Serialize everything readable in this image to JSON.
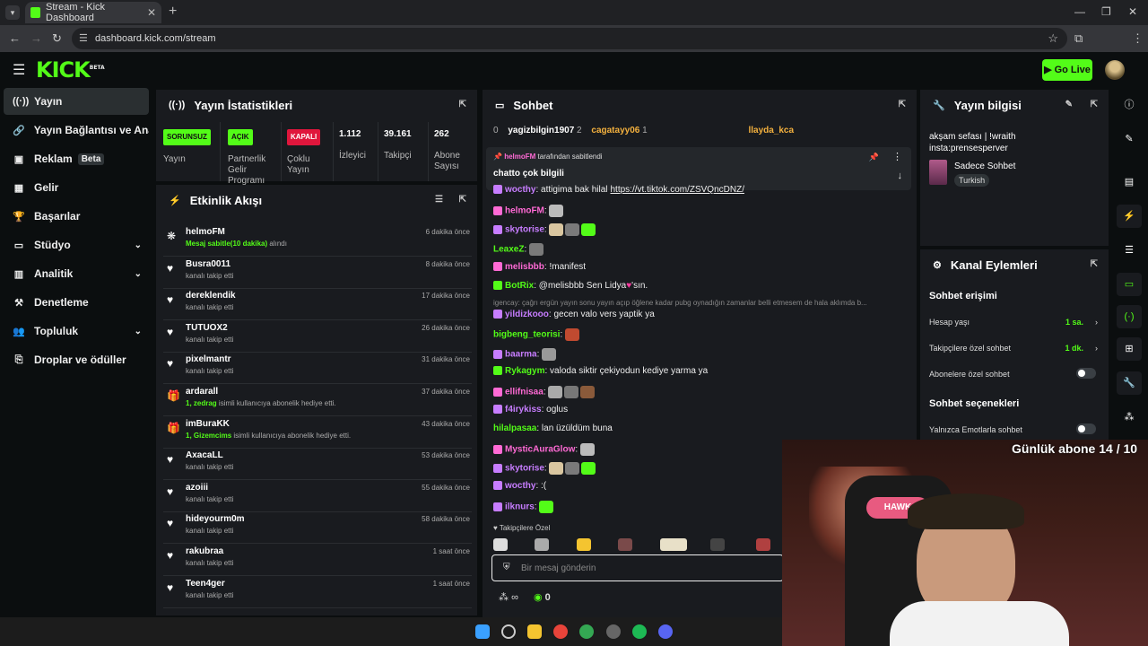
{
  "browser": {
    "tab_title": "Stream - Kick Dashboard",
    "url": "dashboard.kick.com/stream"
  },
  "app": {
    "logo": "KICK",
    "logo_tag": "BETA",
    "go_live": "Go Live"
  },
  "sidebar": {
    "items": [
      {
        "label": "Yayın",
        "icon": "broadcast-icon"
      },
      {
        "label": "Yayın Bağlantısı ve Anahtarı",
        "icon": "link-icon"
      },
      {
        "label": "Reklam",
        "icon": "ad-icon",
        "badge": "Beta"
      },
      {
        "label": "Gelir",
        "icon": "revenue-icon"
      },
      {
        "label": "Başarılar",
        "icon": "trophy-icon"
      },
      {
        "label": "Stüdyo",
        "icon": "studio-icon"
      },
      {
        "label": "Analitik",
        "icon": "analytics-icon"
      },
      {
        "label": "Denetleme",
        "icon": "moderation-icon"
      },
      {
        "label": "Topluluk",
        "icon": "community-icon"
      },
      {
        "label": "Droplar ve ödüller",
        "icon": "drops-icon"
      }
    ]
  },
  "stats": {
    "title": "Yayın İstatistikleri",
    "items": [
      {
        "badge": "SORUNSUZ",
        "label": "Yayın"
      },
      {
        "badge": "AÇIK",
        "label": "Partnerlik Gelir Programı"
      },
      {
        "badge": "KAPALI",
        "label": "Çoklu Yayın"
      },
      {
        "value": "1.112",
        "label": "İzleyici"
      },
      {
        "value": "39.161",
        "label": "Takipçi"
      },
      {
        "value": "262",
        "label": "Abone Sayısı"
      }
    ]
  },
  "activity": {
    "title": "Etkinlik Akışı",
    "rows": [
      {
        "name": "helmoFM",
        "sub": "Mesaj sabitle(10 dakika)",
        "sub2": " alındı",
        "time": "6 dakika önce"
      },
      {
        "name": "Busra0011",
        "sub": "kanalı takip etti",
        "time": "8 dakika önce"
      },
      {
        "name": "dereklendik",
        "sub": "kanalı takip etti",
        "time": "17 dakika önce"
      },
      {
        "name": "TUTUOX2",
        "sub": "kanalı takip etti",
        "time": "26 dakika önce"
      },
      {
        "name": "pixelmantr",
        "sub": "kanalı takip etti",
        "time": "31 dakika önce"
      },
      {
        "name": "ardarall",
        "sub": "1, zedrag",
        "sub2": " isimli kullanıcıya abonelik hediye etti.",
        "time": "37 dakika önce"
      },
      {
        "name": "imBuraKK",
        "sub": "1, Gizemcims",
        "sub2": " isimli kullanıcıya abonelik hediye etti.",
        "time": "43 dakika önce"
      },
      {
        "name": "AxacaLL",
        "sub": "kanalı takip etti",
        "time": "53 dakika önce"
      },
      {
        "name": "azoiii",
        "sub": "kanalı takip etti",
        "time": "55 dakika önce"
      },
      {
        "name": "hideyourm0m",
        "sub": "kanalı takip etti",
        "time": "58 dakika önce"
      },
      {
        "name": "rakubraa",
        "sub": "kanalı takip etti",
        "time": "1 saat önce"
      },
      {
        "name": "Teen4ger",
        "sub": "kanalı takip etti",
        "time": "1 saat önce"
      }
    ]
  },
  "chat": {
    "title": "Sohbet",
    "top": {
      "rank_count": "0",
      "user1": "yagizbilgin1907",
      "n1": "2",
      "user2": "cagatayy06",
      "n2": "1",
      "user3": "llayda_kca"
    },
    "pinned_by": "helmoFM",
    "pinned_by_suffix": "tarafından sabitlendi",
    "pinned_msg": "chatto çok bilgili",
    "lines": [
      {
        "user": "wocthy",
        "color": "#c77dff",
        "text": "attigima bak hilal",
        "link": "https://vt.tiktok.com/ZSVQncDNZ/"
      },
      {
        "user": "helmoFM",
        "color": "#ff6ad5",
        "text": ""
      },
      {
        "user": "skytorise",
        "color": "#c77dff",
        "text": ""
      },
      {
        "user": "LeaxeZ",
        "color": "#53fc18",
        "text": ""
      },
      {
        "user": "melisbbb",
        "color": "#ff6ad5",
        "text": "!manifest"
      },
      {
        "user": "BotRix",
        "color": "#53fc18",
        "text": "@melisbbb Sen Lidya",
        "text2": "'sın."
      },
      {
        "reply": "igencay: çağrı ergün yayın sonu yayın açıp öğlene kadar pubg oynadığın zamanlar belli etmesem de hala aklımda b..."
      },
      {
        "user": "yildizkooo",
        "color": "#c77dff",
        "text": "gecen valo vers yaptik ya"
      },
      {
        "user": "bigbeng_teorisi",
        "color": "#53fc18",
        "text": ""
      },
      {
        "user": "baarma",
        "color": "#c77dff",
        "text": ""
      },
      {
        "user": "Rykagym",
        "color": "#53fc18",
        "text": "valoda siktir çekiyodun kediye yarma ya"
      },
      {
        "user": "ellifnisaa",
        "color": "#ff6ad5",
        "text": ""
      },
      {
        "user": "f4irykiss",
        "color": "#c77dff",
        "text": "oglus"
      },
      {
        "user": "hilalpasaa",
        "color": "#53fc18",
        "text": "lan üzüldüm buna"
      },
      {
        "user": "MysticAuraGlow",
        "color": "#ff6ad5",
        "text": ""
      },
      {
        "user": "skytorise",
        "color": "#c77dff",
        "text": ""
      },
      {
        "user": "wocthy",
        "color": "#c77dff",
        "text": ":("
      },
      {
        "user": "ilknurs",
        "color": "#c77dff",
        "text": ""
      }
    ],
    "followers_only": "Takipçilere Özel",
    "input_placeholder": "Bir mesaj gönderin",
    "footer_infinity": "∞",
    "footer_count": "0"
  },
  "stream_info": {
    "title": "Yayın bilgisi",
    "desc": "akşam sefası | !wraith insta:prensesperver",
    "category": "Sadece Sohbet",
    "language": "Turkish"
  },
  "channel_actions": {
    "title": "Kanal Eylemleri",
    "section1": "Sohbet erişimi",
    "account_age_label": "Hesap yaşı",
    "account_age_value": "1 sa.",
    "followers_label": "Takipçilere özel sohbet",
    "followers_value": "1 dk.",
    "subs_label": "Abonelere özel sohbet",
    "section2": "Sohbet seçenekleri",
    "emote_label": "Yalnızca Emotlarla sohbet"
  },
  "overlay": {
    "sub_goal": "Günlük abone 14 / 10",
    "chair_brand": "HAWK"
  },
  "colors": {
    "accent": "#53fc18",
    "panel": "#191b1f",
    "bg": "#0b0e0f"
  }
}
